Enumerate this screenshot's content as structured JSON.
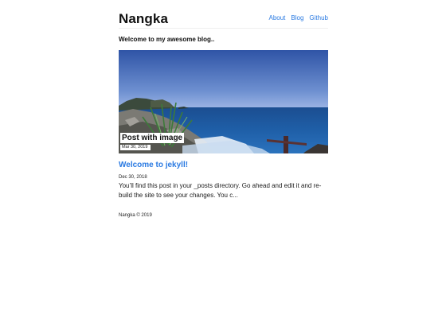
{
  "header": {
    "site_title": "Nangka",
    "nav": [
      {
        "label": "About"
      },
      {
        "label": "Blog"
      },
      {
        "label": "Github"
      }
    ]
  },
  "intro": "Welcome to my awesome blog..",
  "featured_post": {
    "title": "Post with image",
    "date": "Mar 30, 2019"
  },
  "post": {
    "title": "Welcome to jekyll!",
    "date": "Dec 30, 2018",
    "excerpt": "You’ll find this post in your _posts directory. Go ahead and edit it and re-build the site to see your changes. You c..."
  },
  "footer": {
    "text": "Nangka © 2019"
  },
  "colors": {
    "link": "#2a7ae2",
    "text": "#1a1a1a",
    "divider": "#eeeeee",
    "background": "#ffffff"
  }
}
